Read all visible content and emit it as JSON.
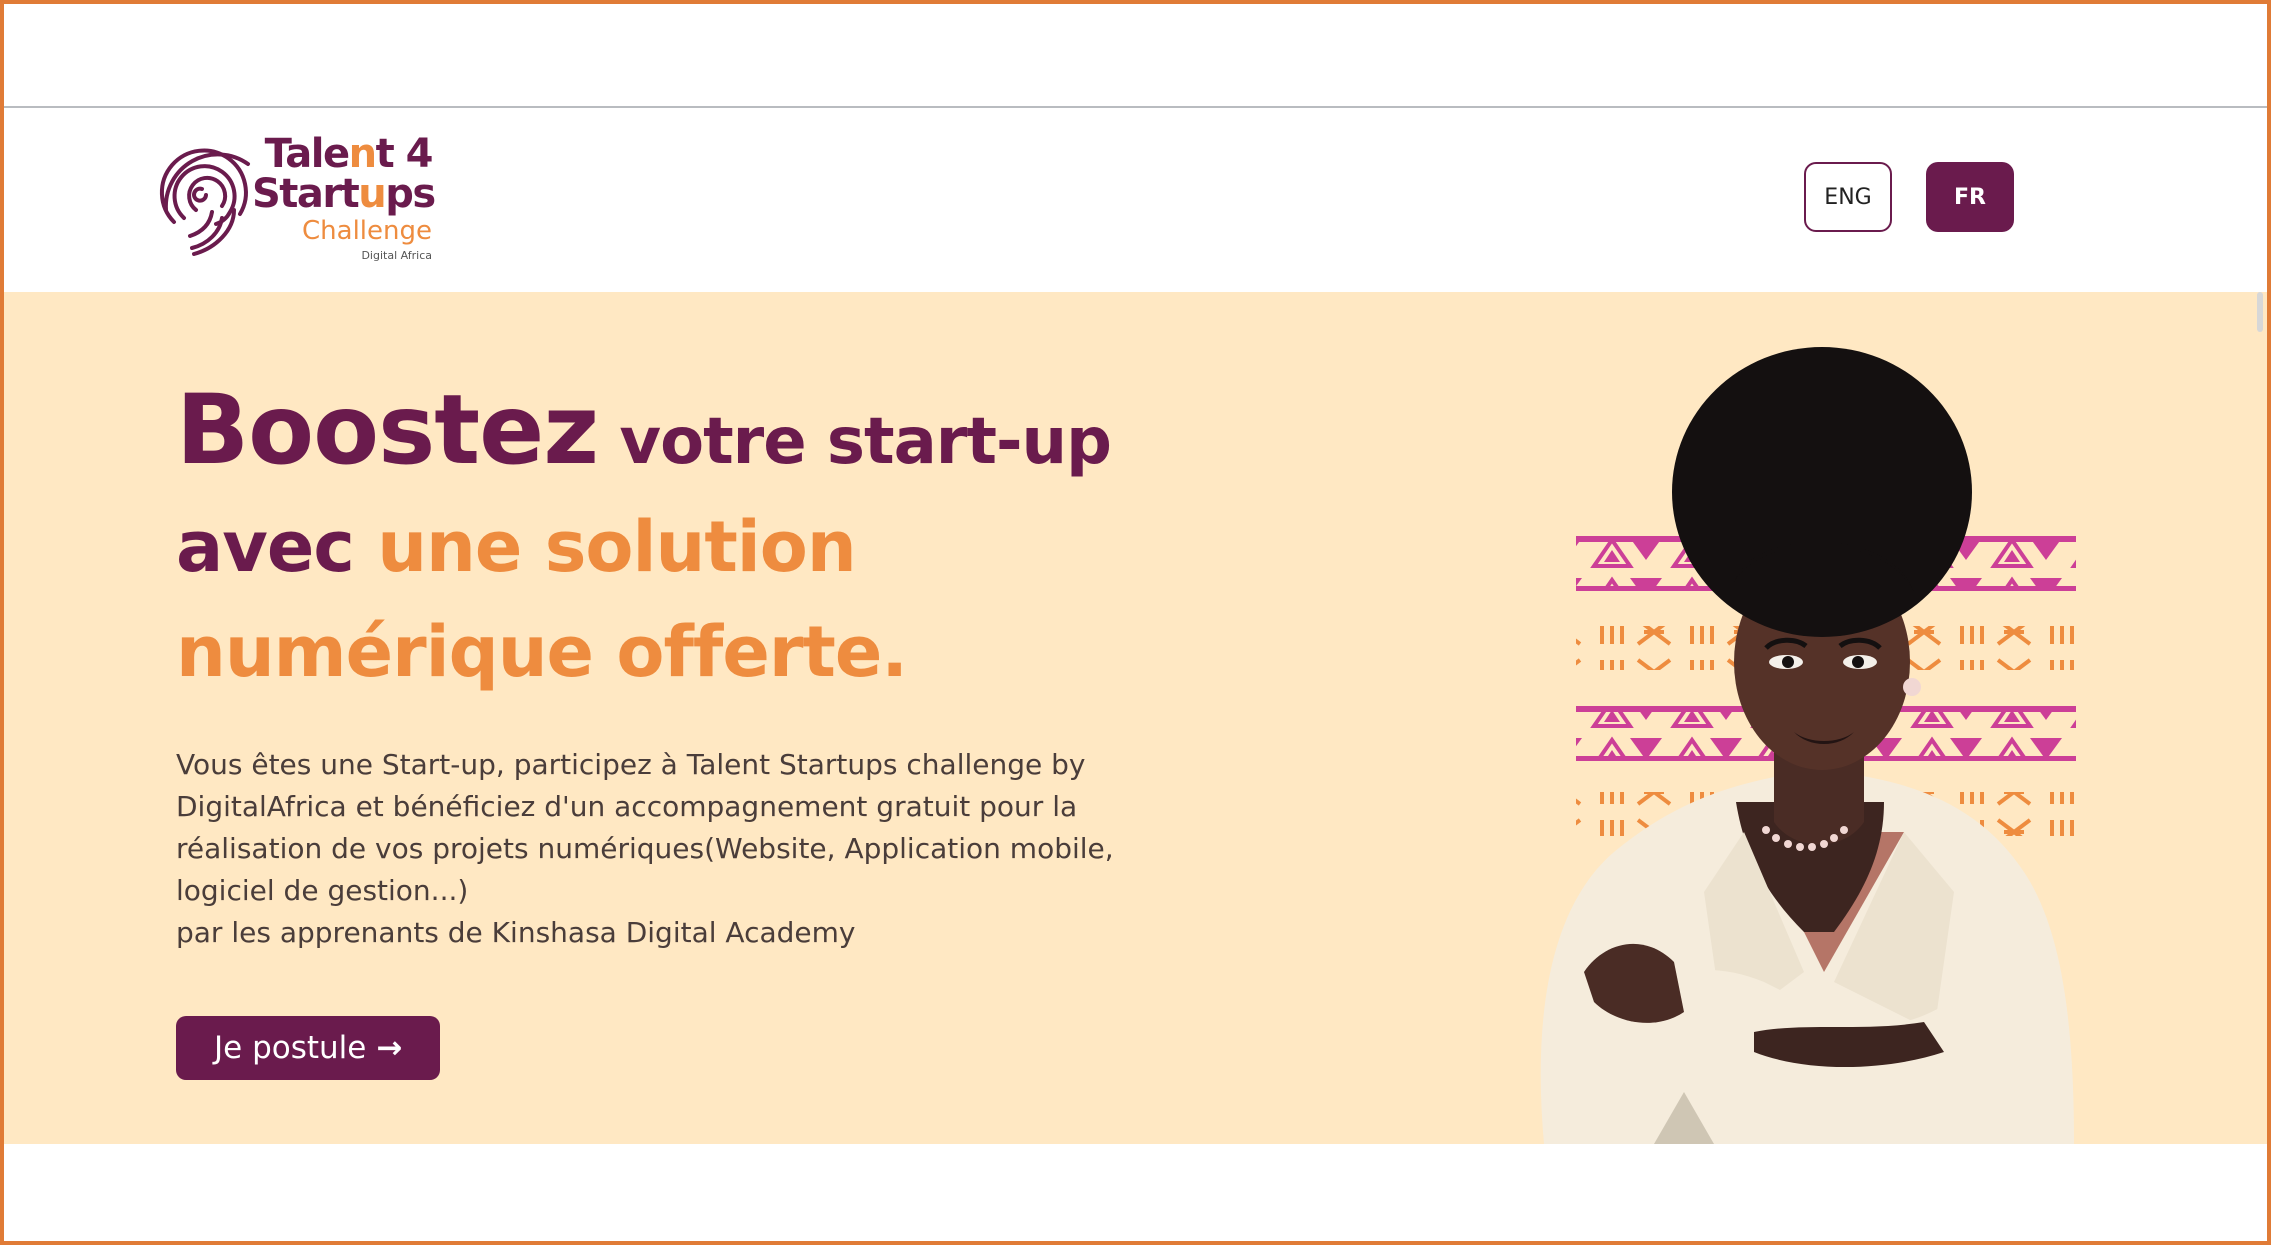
{
  "header": {
    "logo": {
      "line1_a": "Tale",
      "line1_b": "n",
      "line1_c": "t 4",
      "line2_a": "Start",
      "line2_b": "u",
      "line2_c": "ps",
      "line3": "Challenge",
      "line4": "Digital Africa",
      "icon": "fingerprint-icon"
    },
    "lang_eng": "ENG",
    "lang_fr": "FR"
  },
  "hero": {
    "headline_word1": "Boostez",
    "headline_rest1": " votre start-up",
    "headline_word2": "avec ",
    "headline_accent2": "une solution",
    "headline_line3": "numérique offerte.",
    "description_lines": [
      "Vous êtes une Start-up, participez à Talent Startups challenge by",
      "DigitalAfrica et bénéficiez d'un accompagnement gratuit pour la",
      "réalisation de vos projets numériques(Website, Application mobile,",
      "logiciel de gestion...)",
      "par les apprenants de Kinshasa Digital Academy"
    ],
    "cta_label": "Je postule",
    "cta_arrow": "→",
    "illustration": "woman-illustration"
  },
  "colors": {
    "brand": "#6a1b4d",
    "accent": "#ee8c3f",
    "hero_bg": "#ffe8c3",
    "frame": "#e07b36"
  }
}
